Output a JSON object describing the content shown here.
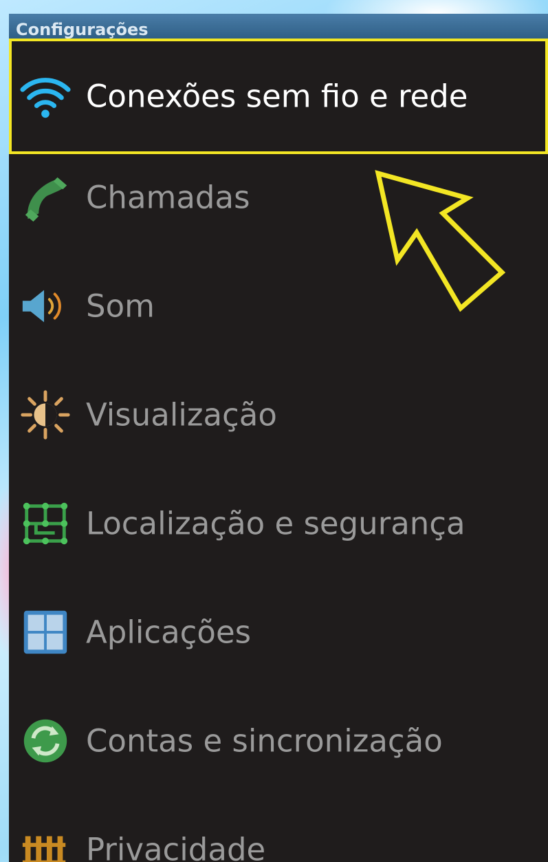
{
  "app": {
    "title": "Configurações"
  },
  "menu": {
    "items": [
      {
        "label": "Conexões sem fio e rede",
        "icon": "wifi-icon"
      },
      {
        "label": "Chamadas",
        "icon": "phone-icon"
      },
      {
        "label": "Som",
        "icon": "speaker-icon"
      },
      {
        "label": "Visualização",
        "icon": "brightness-icon"
      },
      {
        "label": "Localização e segurança",
        "icon": "location-security-icon"
      },
      {
        "label": "Aplicações",
        "icon": "applications-icon"
      },
      {
        "label": "Contas e sincronização",
        "icon": "sync-icon"
      },
      {
        "label": "Privacidade",
        "icon": "privacy-icon"
      }
    ]
  },
  "colors": {
    "highlight": "#f3e624",
    "background": "#1f1c1c",
    "selected_text": "#ffffff",
    "text": "#9a9a9a",
    "titlebar": "#3f6f99"
  }
}
